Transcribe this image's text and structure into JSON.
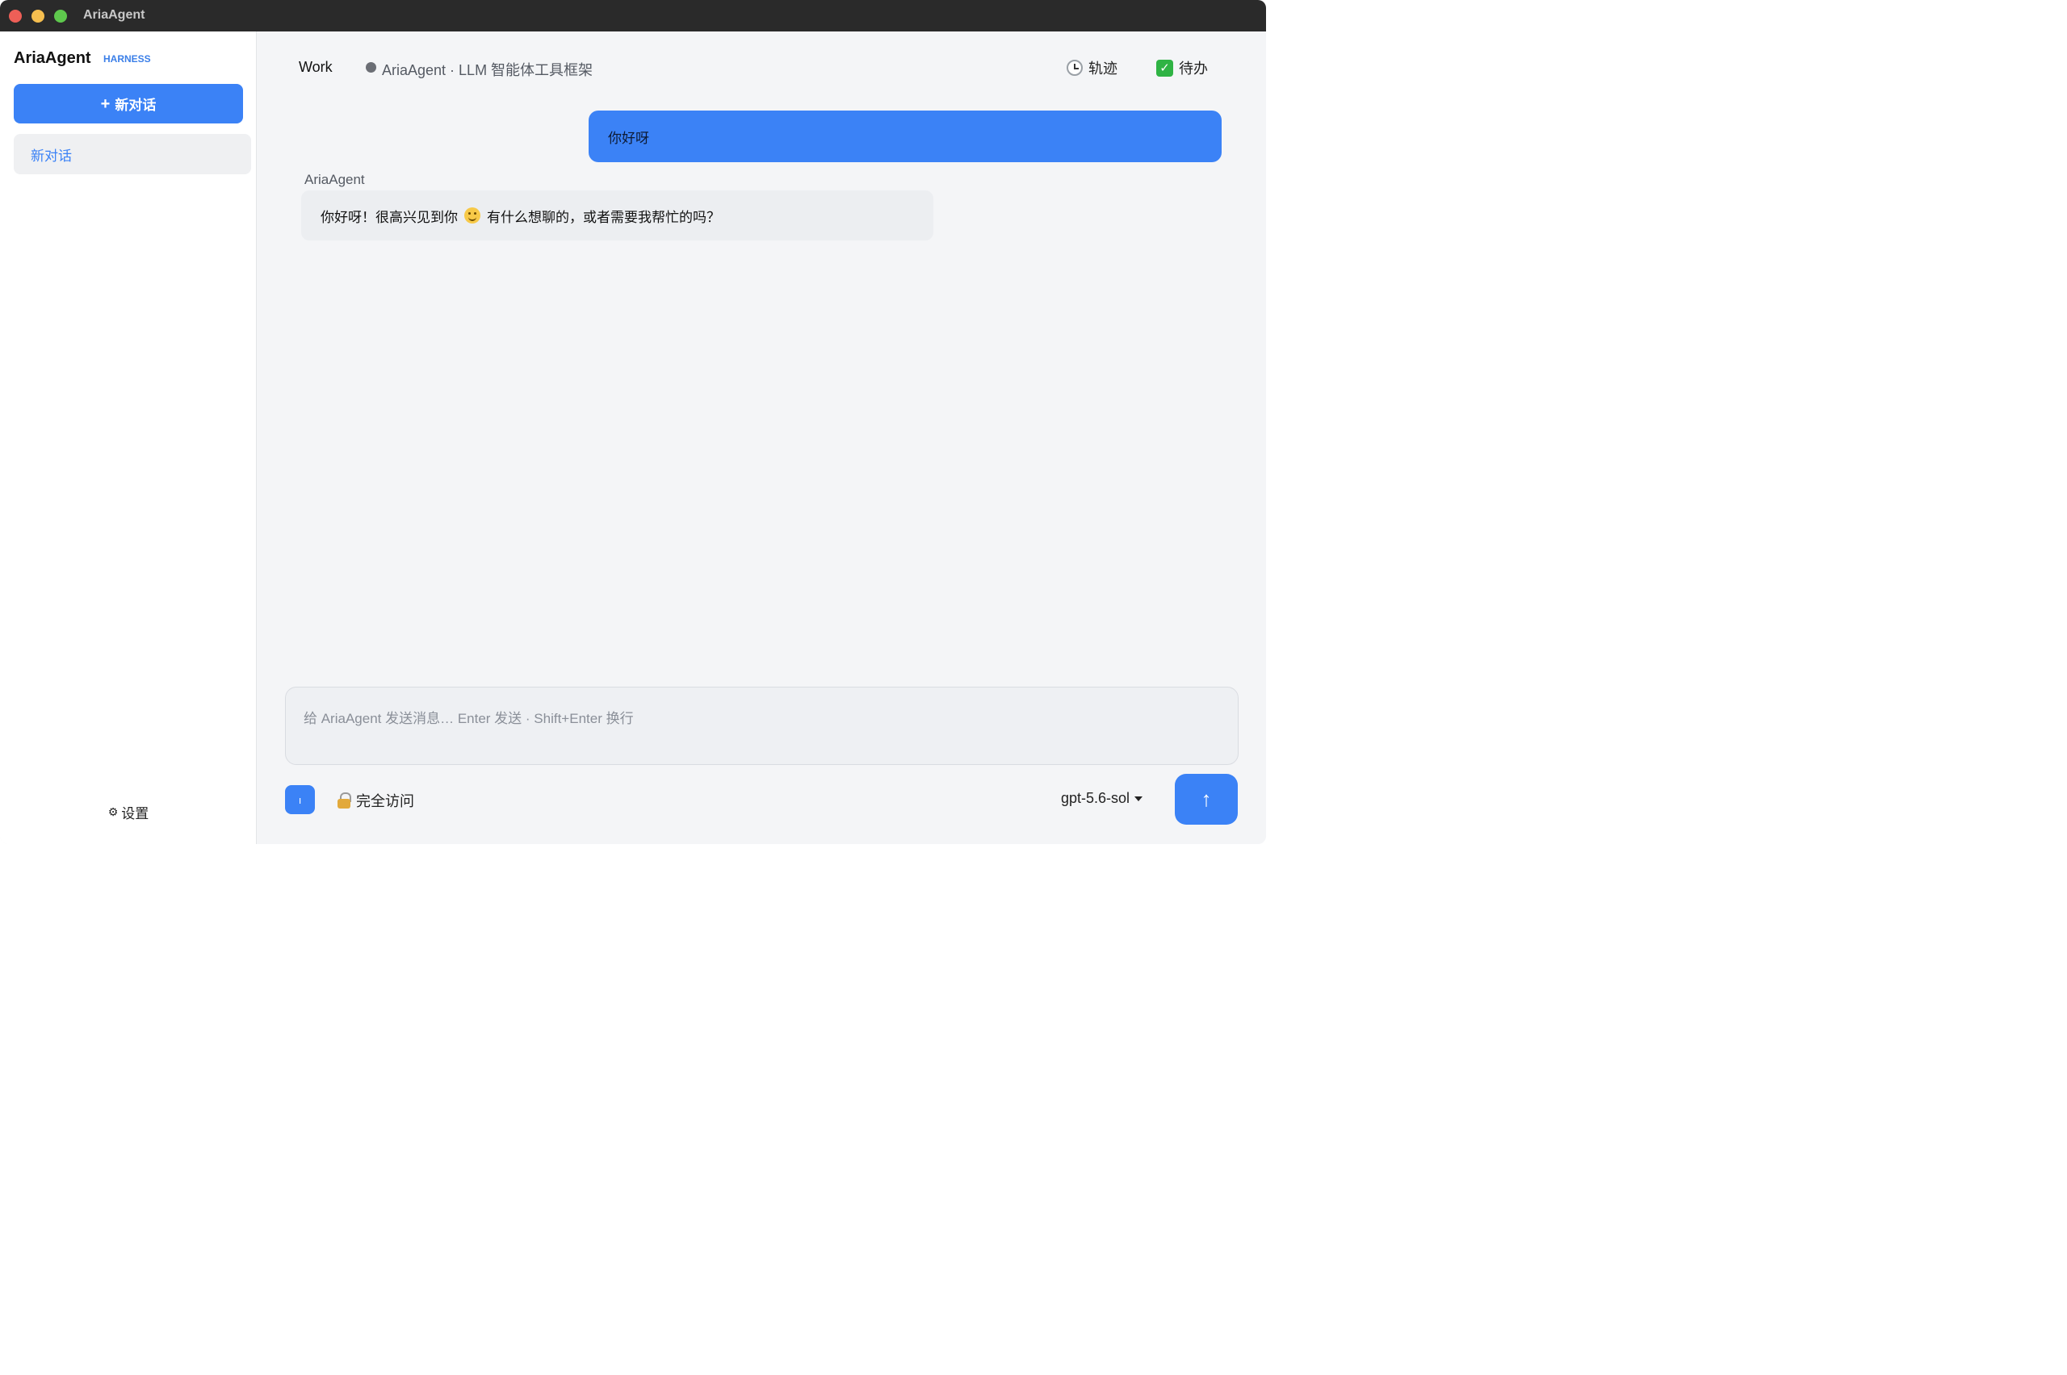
{
  "window": {
    "title": "AriaAgent"
  },
  "sidebar": {
    "brand": "AriaAgent",
    "brand_tag": "HARNESS",
    "new_chat_icon": "+",
    "new_chat_label": "新对话",
    "conversations": [
      {
        "label": "新对话"
      }
    ],
    "settings_icon": "⚙",
    "settings_label": "设置"
  },
  "header": {
    "workspace": "Work",
    "project": "AriaAgent · LLM 智能体工具框架",
    "trace_label": "轨迹",
    "todo_icon": "✓",
    "todo_label": "待办"
  },
  "messages": [
    {
      "role": "user",
      "text": "你好呀"
    },
    {
      "role": "assistant",
      "name": "AriaAgent",
      "text_before": "你好呀！很高兴见到你",
      "text_after": "有什么想聊的，或者需要我帮忙的吗？"
    }
  ],
  "composer": {
    "placeholder": "给 AriaAgent 发送消息… Enter 发送 · Shift+Enter 换行",
    "value": "",
    "attach_icon": "ı",
    "access_label": "完全访问",
    "model": "gpt-5.6-sol",
    "send_icon": "↑"
  },
  "colors": {
    "accent": "#3b82f6",
    "sidebar_bg": "#ffffff",
    "main_bg": "#f4f5f7"
  }
}
